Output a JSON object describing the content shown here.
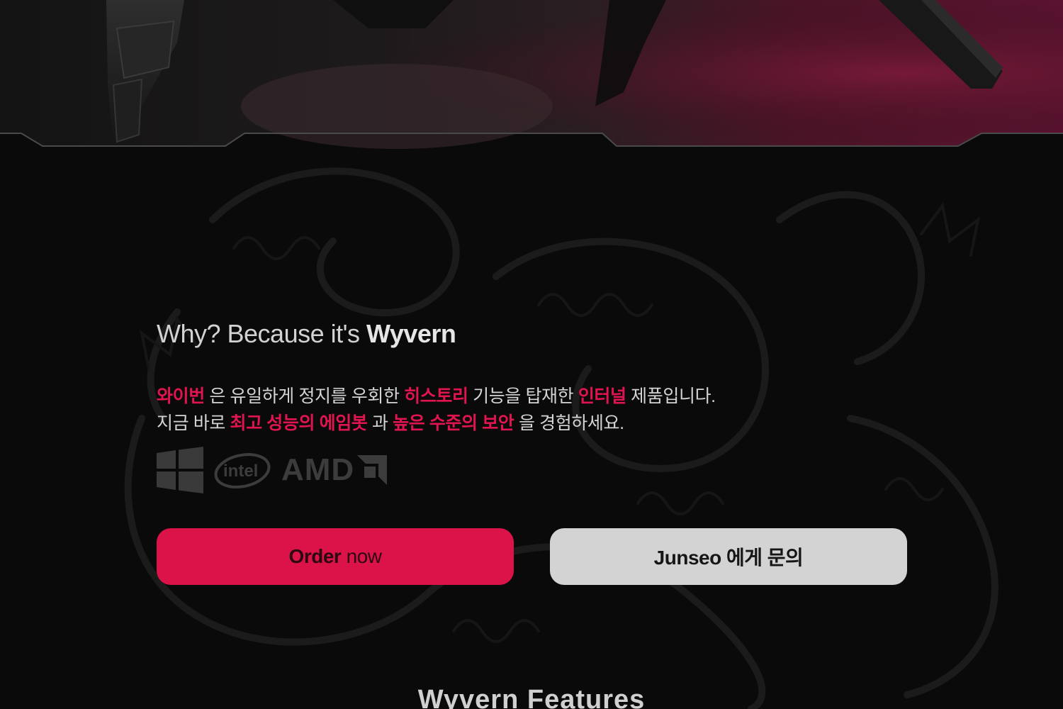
{
  "why": {
    "prefix": "Why? Because it's ",
    "brand": "Wyvern"
  },
  "description": {
    "line1": [
      {
        "text": "와이번",
        "highlight": true
      },
      {
        "text": " 은 유일하게 정지를 우회한 ",
        "highlight": false
      },
      {
        "text": "히스토리",
        "highlight": true
      },
      {
        "text": " 기능을 탑재한 ",
        "highlight": false
      },
      {
        "text": "인터널",
        "highlight": true
      },
      {
        "text": " 제품입니다.",
        "highlight": false
      }
    ],
    "line2": [
      {
        "text": "지금 바로 ",
        "highlight": false
      },
      {
        "text": "최고 성능의 에임봇",
        "highlight": true
      },
      {
        "text": " 과 ",
        "highlight": false
      },
      {
        "text": "높은 수준의 보안",
        "highlight": true
      },
      {
        "text": " 을 경험하세요.",
        "highlight": false
      }
    ]
  },
  "logos": {
    "windows": "windows-logo-icon",
    "intel": "intel",
    "amd": "AMD"
  },
  "buttons": {
    "order_bold": "Order",
    "order_light": " now",
    "contact": "Junseo 에게 문의"
  },
  "features": {
    "title": "Wyvern Features"
  },
  "colors": {
    "accent": "#e0144f",
    "button_primary": "#dc1349",
    "button_secondary": "#d3d3d3",
    "background": "#0b0a0b"
  }
}
